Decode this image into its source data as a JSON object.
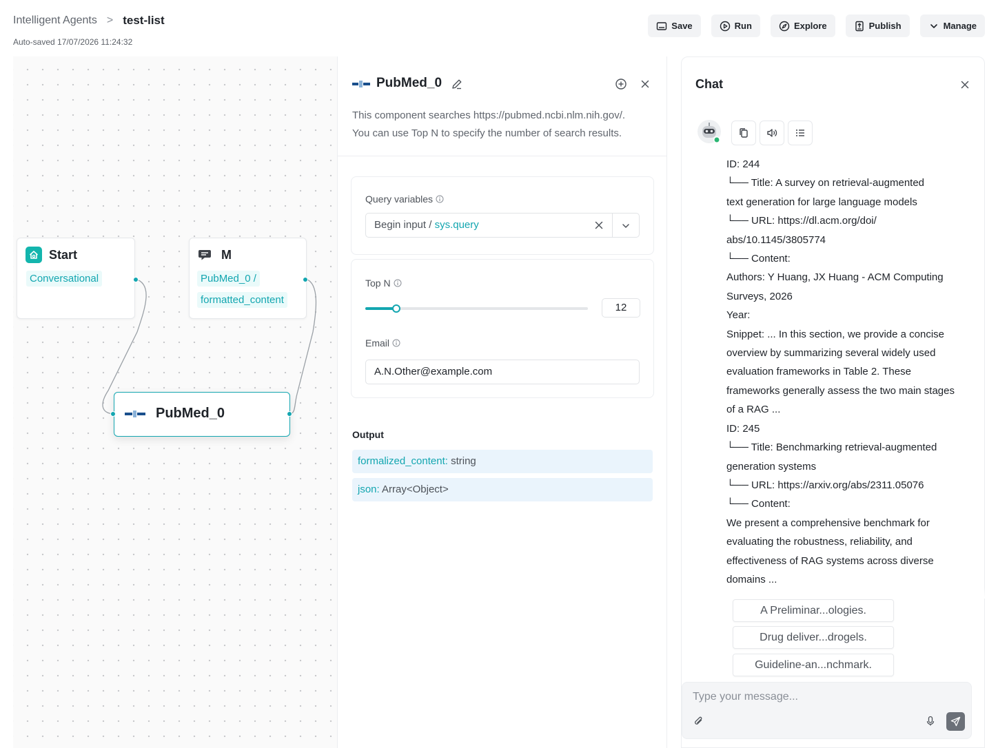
{
  "breadcrumb": {
    "parent": "Intelligent Agents",
    "separator": ">",
    "current": "test-list"
  },
  "autosaved": "Auto-saved 17/07/2026 11:24:32",
  "toolbar": {
    "save": "Save",
    "run": "Run",
    "explore": "Explore",
    "publish": "Publish",
    "manage": "Manage"
  },
  "canvas": {
    "start_node": {
      "title": "Start",
      "output": "Conversational"
    },
    "message_node": {
      "title": "M",
      "line1": "PubMed_0 /",
      "line2": "formatted_content"
    },
    "pubmed_node": {
      "title": "PubMed_0"
    }
  },
  "config": {
    "title": "PubMed_0",
    "description_line1": "This component searches https://pubmed.ncbi.nlm.nih.gov/.",
    "description_line2": "You can use Top N to specify the number of search results.",
    "query_variables": {
      "label": "Query variables",
      "prefix": "Begin input / ",
      "value": "sys.query"
    },
    "top_n": {
      "label": "Top N",
      "value": "12",
      "fraction": 0.14
    },
    "email": {
      "label": "Email",
      "value": "A.N.Other@example.com"
    },
    "output": {
      "label": "Output",
      "items": [
        {
          "key": "formalized_content:",
          "type": " string"
        },
        {
          "key": "json:",
          "type": " Array<Object>"
        }
      ]
    }
  },
  "chat": {
    "title": "Chat",
    "message_lines": [
      "ID: 244",
      " └── Title: A survey on retrieval-augmented",
      "text generation for large language models",
      " └── URL: https://dl.acm.org/doi/",
      "abs/10.1145/3805774",
      " └── Content:",
      "Authors: Y Huang, JX Huang - ACM Computing",
      "Surveys, 2026",
      "Year:",
      "Snippet: ... In this section, we provide a concise",
      "overview by summarizing several widely used",
      "evaluation frameworks in Table 2. These",
      "frameworks generally assess the two main stages",
      "of a RAG ...",
      "ID: 245",
      " └── Title: Benchmarking retrieval-augmented",
      "generation systems",
      " └── URL: https://arxiv.org/abs/2311.05076",
      " └── Content:",
      "We present a comprehensive benchmark for",
      "evaluating the robustness, reliability, and",
      "effectiveness of RAG systems across diverse",
      "domains ..."
    ],
    "suggestions": [
      "A Preliminar...ologies.",
      "Drug deliver...drogels.",
      "Guideline-an...nchmark."
    ],
    "input_placeholder": "Type your message..."
  },
  "colors": {
    "accent": "#13a6b0",
    "output_bg": "#eaf4fc"
  },
  "icons": [
    "save-icon",
    "play-icon",
    "compass-icon",
    "publish-icon",
    "chevron-down-icon",
    "edit-icon",
    "plus-circle-icon",
    "close-icon",
    "copy-icon",
    "speaker-icon",
    "list-icon",
    "attach-icon",
    "mic-icon",
    "send-icon"
  ]
}
